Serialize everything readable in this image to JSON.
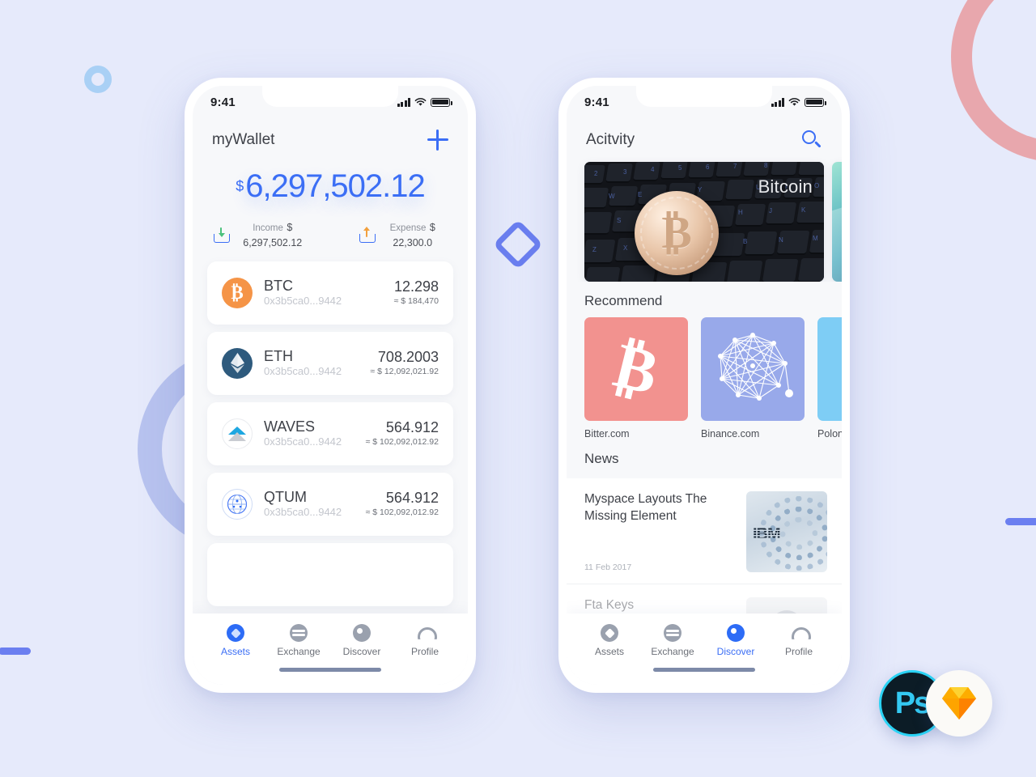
{
  "background": {
    "color": "#e6eafb"
  },
  "decorations": {
    "pink_ring": "#e8a7ad",
    "periwinkle_ring": "#b8c3ef",
    "lightblue_ring": "#a9d0f5",
    "diamond_mark": "#6b7ff0",
    "bar_color": "#6b7ff0"
  },
  "accent": {
    "primary": "#3b6ef5",
    "muted": "#6c7078"
  },
  "phone1": {
    "status": {
      "time": "9:41",
      "signal_icon": "signal-bars-icon",
      "wifi_icon": "wifi-icon",
      "battery_icon": "battery-icon"
    },
    "header": {
      "title": "myWallet",
      "add_icon": "plus-icon"
    },
    "balance": {
      "currency_symbol": "$",
      "amount": "6,297,502.12",
      "income": {
        "label": "Income",
        "value": "$ 6,297,502.12",
        "icon": "tray-download-icon"
      },
      "expense": {
        "label": "Expense",
        "value": "$ 22,300.0",
        "icon": "tray-upload-icon"
      }
    },
    "assets": [
      {
        "symbol": "BTC",
        "address": "0x3b5ca0...9442",
        "amount": "12.298",
        "fiat": "≈ $ 184,470",
        "icon": "bitcoin-coin-icon"
      },
      {
        "symbol": "ETH",
        "address": "0x3b5ca0...9442",
        "amount": "708.2003",
        "fiat": "≈ $ 12,092,021.92",
        "icon": "ethereum-coin-icon"
      },
      {
        "symbol": "WAVES",
        "address": "0x3b5ca0...9442",
        "amount": "564.912",
        "fiat": "≈ $ 102,092,012.92",
        "icon": "waves-coin-icon"
      },
      {
        "symbol": "QTUM",
        "address": "0x3b5ca0...9442",
        "amount": "564.912",
        "fiat": "≈ $ 102,092,012.92",
        "icon": "qtum-coin-icon"
      }
    ],
    "tabs": [
      {
        "label": "Assets",
        "icon": "assets-icon",
        "active": true
      },
      {
        "label": "Exchange",
        "icon": "exchange-icon",
        "active": false
      },
      {
        "label": "Discover",
        "icon": "discover-icon",
        "active": false
      },
      {
        "label": "Profile",
        "icon": "profile-icon",
        "active": false
      }
    ]
  },
  "phone2": {
    "status": {
      "time": "9:41",
      "signal_icon": "signal-bars-icon",
      "wifi_icon": "wifi-icon",
      "battery_icon": "battery-icon"
    },
    "header": {
      "title": "Acitvity",
      "search_icon": "search-icon"
    },
    "banners": [
      {
        "label": "Bitcoin",
        "image": "bitcoin-coin-on-keyboard-photo"
      },
      {
        "label": "",
        "image": "ocean-wave-photo"
      }
    ],
    "recommend": {
      "title": "Recommend",
      "items": [
        {
          "name": "Bitter.com",
          "icon": "bitcoin-logo-icon",
          "color": "#f2928f"
        },
        {
          "name": "Binance.com",
          "icon": "network-graph-icon",
          "color": "#98a9ea"
        },
        {
          "name": "Polonie",
          "icon": "poloniex-logo-icon",
          "color": "#7ecdf5"
        }
      ]
    },
    "news": {
      "title": "News",
      "items": [
        {
          "title": "Myspace Layouts The Missing Element",
          "date": "11 Feb 2017",
          "thumb": "ibm-server-photo"
        },
        {
          "title": "Fta Keys",
          "date": "",
          "thumb": "person-portrait-photo"
        }
      ]
    },
    "tabs": [
      {
        "label": "Assets",
        "icon": "assets-icon",
        "active": false
      },
      {
        "label": "Exchange",
        "icon": "exchange-icon",
        "active": false
      },
      {
        "label": "Discover",
        "icon": "discover-icon",
        "active": true
      },
      {
        "label": "Profile",
        "icon": "profile-icon",
        "active": false
      }
    ]
  },
  "badges": [
    {
      "name": "Photoshop",
      "label": "Ps",
      "icon": "photoshop-icon"
    },
    {
      "name": "Sketch",
      "label": "",
      "icon": "sketch-diamond-icon"
    }
  ]
}
